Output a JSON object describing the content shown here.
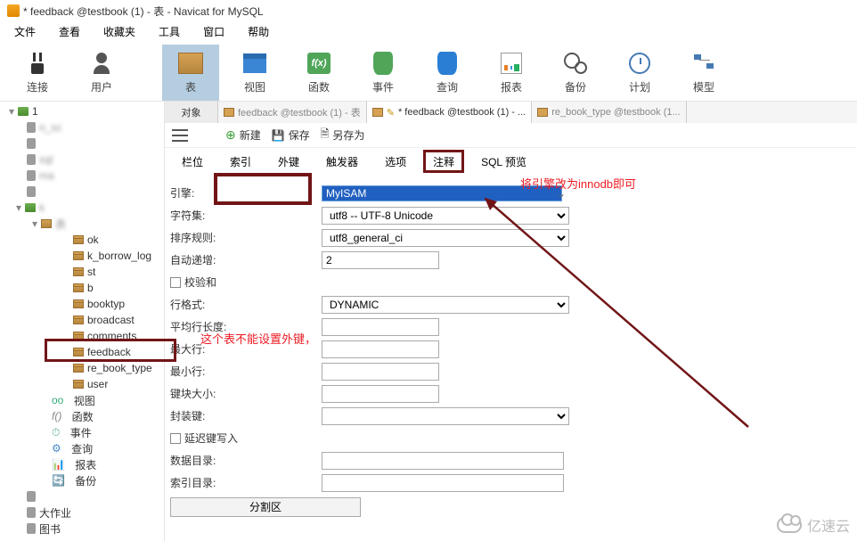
{
  "title": "* feedback @testbook (1) - 表 - Navicat for MySQL",
  "menu": {
    "file": "文件",
    "view": "查看",
    "fav": "收藏夹",
    "tools": "工具",
    "window": "窗口",
    "help": "帮助"
  },
  "toolbar": {
    "conn": "连接",
    "user": "用户",
    "table": "表",
    "view": "视图",
    "func": "函数",
    "event": "事件",
    "query": "查询",
    "report": "报表",
    "backup": "备份",
    "plan": "计划",
    "model": "模型"
  },
  "tree": {
    "root": "1",
    "items": [
      "ok",
      "k_borrow_log",
      "st",
      "b",
      "booktyp",
      "broadcast",
      "comments",
      "feedback",
      "re_book_type",
      "user"
    ],
    "groups": {
      "view": "视图",
      "func": "函数",
      "event": "事件",
      "query": "查询",
      "report": "报表",
      "backup": "备份"
    },
    "bottom": "大作业",
    "bottom2": "图书"
  },
  "tabs": {
    "obj": "对象",
    "t1": "feedback @testbook (1) - 表",
    "t2": "* feedback @testbook (1) - ...",
    "t3": "re_book_type @testbook (1..."
  },
  "subtoolbar": {
    "new": "新建",
    "save": "保存",
    "saveas": "另存为"
  },
  "dtabs": {
    "fields": "栏位",
    "index": "索引",
    "fk": "外键",
    "trigger": "触发器",
    "options": "选项",
    "comment": "注释",
    "sql": "SQL 预览"
  },
  "form": {
    "engine_label": "引擎:",
    "engine_value": "MyISAM",
    "charset_label": "字符集:",
    "charset_value": "utf8 -- UTF-8 Unicode",
    "collate_label": "排序规则:",
    "collate_value": "utf8_general_ci",
    "autoinc_label": "自动递增:",
    "autoinc_value": "2",
    "checksum_label": "校验和",
    "rowformat_label": "行格式:",
    "rowformat_value": "DYNAMIC",
    "avgrow_label": "平均行长度:",
    "maxrows_label": "最大行:",
    "minrows_label": "最小行:",
    "keyblock_label": "键块大小:",
    "packkeys_label": "封装键:",
    "delaywrite_label": "延迟键写入",
    "datadir_label": "数据目录:",
    "indexdir_label": "索引目录:",
    "partition_label": "分割区"
  },
  "annotations": {
    "note1": "将引擎改为innodb即可",
    "note2": "这个表不能设置外键，"
  },
  "watermark": "亿速云"
}
